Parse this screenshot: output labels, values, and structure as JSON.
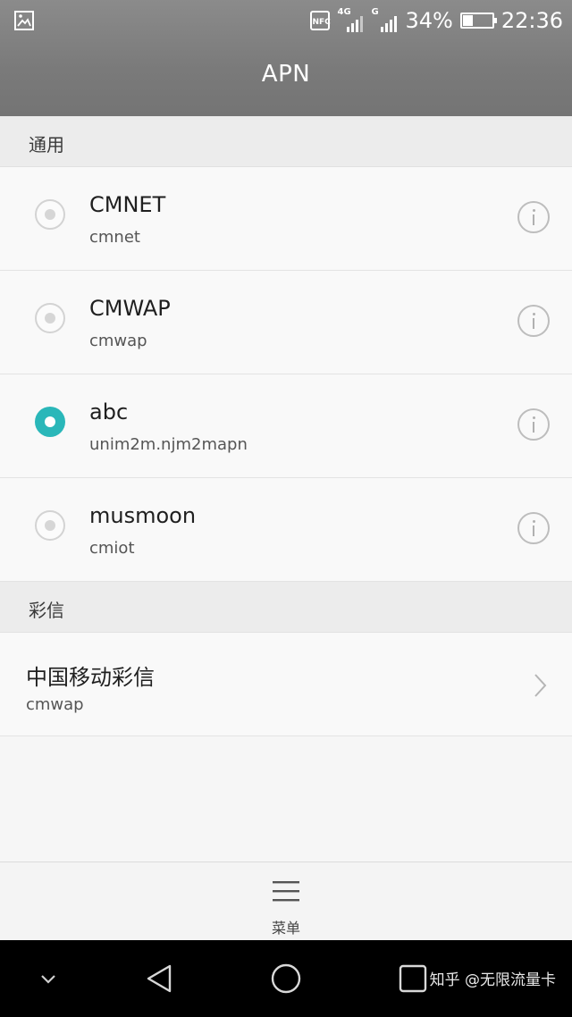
{
  "status_bar": {
    "nfc_label": "NFC",
    "network_1": "4G",
    "network_2": "G",
    "battery": "34%",
    "battery_level": 0.34,
    "time": "22:36"
  },
  "header": {
    "title": "APN"
  },
  "sections": {
    "general": "通用",
    "mms": "彩信"
  },
  "apn_list": [
    {
      "name": "CMNET",
      "apn": "cmnet",
      "selected": false
    },
    {
      "name": "CMWAP",
      "apn": "cmwap",
      "selected": false
    },
    {
      "name": "abc",
      "apn": "unim2m.njm2mapn",
      "selected": true
    },
    {
      "name": "musmoon",
      "apn": "cmiot",
      "selected": false
    }
  ],
  "mms_list": [
    {
      "name": "中国移动彩信",
      "apn": "cmwap"
    }
  ],
  "bottom_menu": {
    "label": "菜单"
  },
  "watermark": "知乎 @无限流量卡",
  "colors": {
    "accent": "#2ab7b9",
    "header": "#7e7e7e"
  }
}
